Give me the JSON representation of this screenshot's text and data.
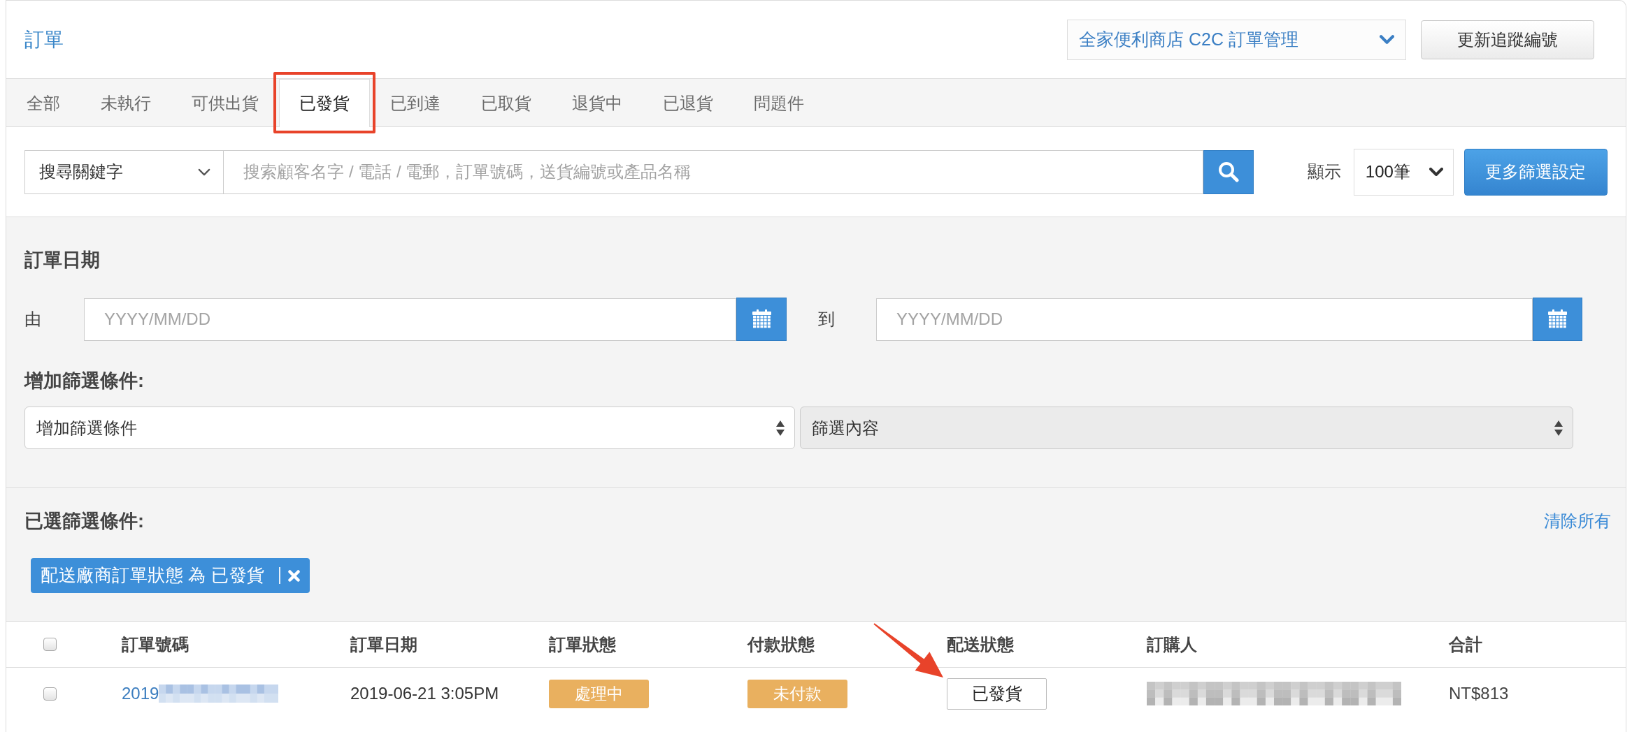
{
  "header": {
    "title": "訂單",
    "store_select": "全家便利商店 C2C 訂單管理",
    "update_button": "更新追蹤編號"
  },
  "tabs": [
    {
      "label": "全部",
      "selected": false,
      "highlighted": false
    },
    {
      "label": "未執行",
      "selected": false,
      "highlighted": false
    },
    {
      "label": "可供出貨",
      "selected": false,
      "highlighted": false
    },
    {
      "label": "已發貨",
      "selected": true,
      "highlighted": true
    },
    {
      "label": "已到達",
      "selected": false,
      "highlighted": false
    },
    {
      "label": "已取貨",
      "selected": false,
      "highlighted": false
    },
    {
      "label": "退貨中",
      "selected": false,
      "highlighted": false
    },
    {
      "label": "已退貨",
      "selected": false,
      "highlighted": false
    },
    {
      "label": "問題件",
      "selected": false,
      "highlighted": false
    }
  ],
  "search": {
    "field_select": "搜尋關鍵字",
    "placeholder": "搜索顧客名字 / 電話 / 電郵，訂單號碼，送貨編號或產品名稱",
    "show_label": "顯示",
    "page_size_select": "100筆",
    "more_filters_button": "更多篩選設定"
  },
  "date_filter": {
    "title": "訂單日期",
    "from": {
      "label": "由",
      "placeholder": "YYYY/MM/DD"
    },
    "to": {
      "label": "到",
      "placeholder": "YYYY/MM/DD"
    }
  },
  "add_filter": {
    "title": "增加篩選條件:",
    "condition_select": {
      "value": "增加篩選條件",
      "disabled": false
    },
    "content_select": {
      "value": "篩選內容",
      "disabled": true
    }
  },
  "selected_filters": {
    "title": "已選篩選條件:",
    "clear_all_link": "清除所有",
    "chips": [
      {
        "label": "配送廠商訂單狀態 為 已發貨"
      }
    ]
  },
  "table": {
    "select_all_checked": false,
    "columns": [
      "訂單號碼",
      "訂單日期",
      "訂單狀態",
      "付款狀態",
      "配送狀態",
      "訂購人",
      "合計"
    ],
    "rows": [
      {
        "checked": false,
        "order_number": {
          "text": "2019",
          "redacted": true
        },
        "date": "2019-06-21 3:05PM",
        "order_status": {
          "label": "處理中",
          "kind": "warning"
        },
        "payment_status": {
          "label": "未付款",
          "kind": "warning"
        },
        "shipping_status": {
          "label": "已發貨",
          "kind": "outline",
          "highlighted": true
        },
        "buyer": {
          "redacted": true
        },
        "total": "NT$813"
      }
    ]
  }
}
